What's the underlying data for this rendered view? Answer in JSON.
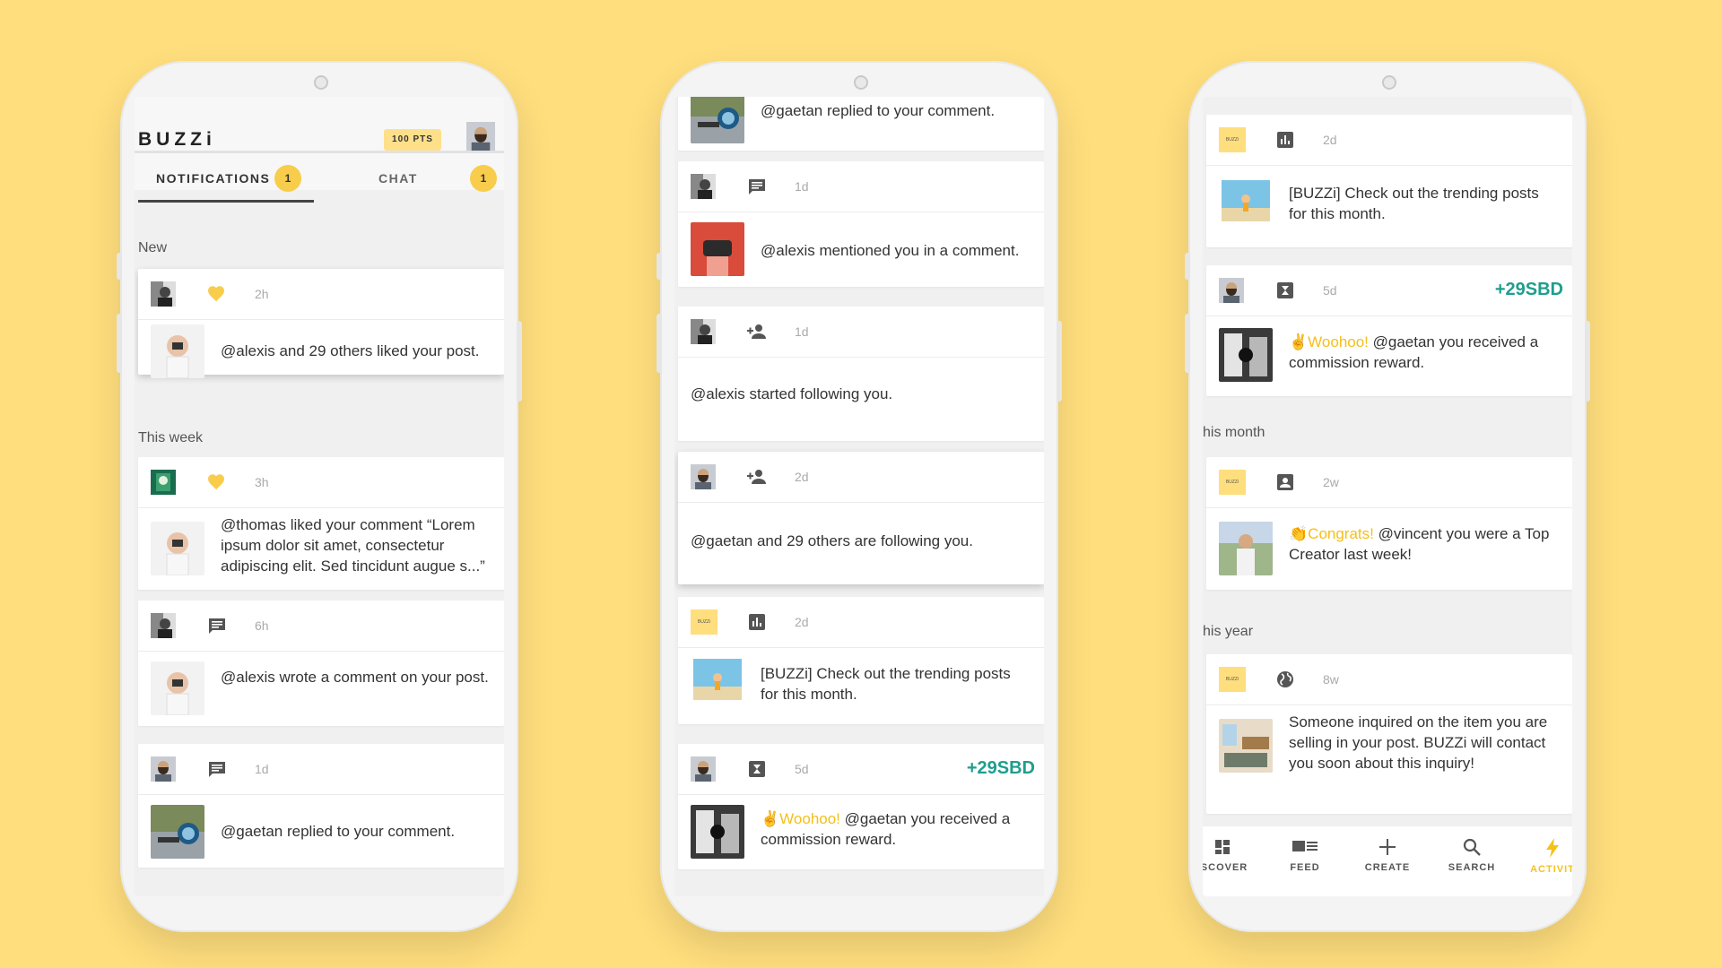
{
  "screen1": {
    "header": {
      "logo": "BUZZi",
      "points": "100 PTS"
    },
    "tabs": [
      {
        "label": "NOTIFICATIONS",
        "badge": "1"
      },
      {
        "label": "CHAT",
        "badge": "1"
      }
    ],
    "sections": {
      "new": "New",
      "this_week": "This week"
    },
    "cards": [
      {
        "icon": "heart-icon",
        "time": "2h",
        "text": "@alexis and 29 others liked your post."
      },
      {
        "icon": "heart-icon",
        "time": "3h",
        "text": "@thomas liked your comment “Lorem ipsum dolor sit amet, consectetur adipiscing elit. Sed tincidunt augue s...”"
      },
      {
        "icon": "comment-icon",
        "time": "6h",
        "text": "@alexis wrote a comment on your post."
      },
      {
        "icon": "comment-icon",
        "time": "1d",
        "text": "@gaetan replied to your comment."
      }
    ]
  },
  "screen2": {
    "cards": [
      {
        "text": "@gaetan replied to your comment."
      },
      {
        "icon": "comment-icon",
        "time": "1d",
        "text": "@alexis mentioned you in a comment."
      },
      {
        "icon": "person-add-icon",
        "time": "1d",
        "text": "@alexis started following you."
      },
      {
        "icon": "person-add-icon",
        "time": "2d",
        "text": "@gaetan and 29 others are following you."
      },
      {
        "icon": "bar-chart-icon",
        "time": "2d",
        "text": "[BUZZi] Check out the trending posts for this month."
      },
      {
        "icon": "reward-icon",
        "time": "5d",
        "reward": "+29SBD",
        "highlight": "✌Woohoo!",
        "text": " @gaetan you received a commission reward."
      }
    ]
  },
  "screen3": {
    "sections": {
      "month": "his month",
      "year": "his year"
    },
    "cards": [
      {
        "icon": "bar-chart-icon",
        "time": "2d",
        "text": "[BUZZi] Check out the trending posts for this month."
      },
      {
        "icon": "reward-icon",
        "time": "5d",
        "reward": "+29SBD",
        "highlight": "✌Woohoo!",
        "text": " @gaetan you received a commission reward."
      },
      {
        "icon": "account-box-icon",
        "time": "2w",
        "highlight": "👏Congrats!",
        "text": " @vincent you were a Top Creator last week!"
      },
      {
        "icon": "globe-icon",
        "time": "8w",
        "text": "Someone inquired on the item you are selling in your post. BUZZi will contact you soon about this inquiry!"
      }
    ],
    "nav": [
      {
        "label": "ISCOVER",
        "icon": "discover-icon"
      },
      {
        "label": "FEED",
        "icon": "feed-icon"
      },
      {
        "label": "CREATE",
        "icon": "plus-icon"
      },
      {
        "label": "SEARCH",
        "icon": "search-icon"
      },
      {
        "label": "ACTIVIT",
        "icon": "bolt-icon",
        "active": true
      }
    ],
    "badge_text": "BUZZi"
  },
  "colors": {
    "background": "#FFDE7D",
    "accent": "#F8CD4B",
    "reward": "#1E9E8E"
  }
}
